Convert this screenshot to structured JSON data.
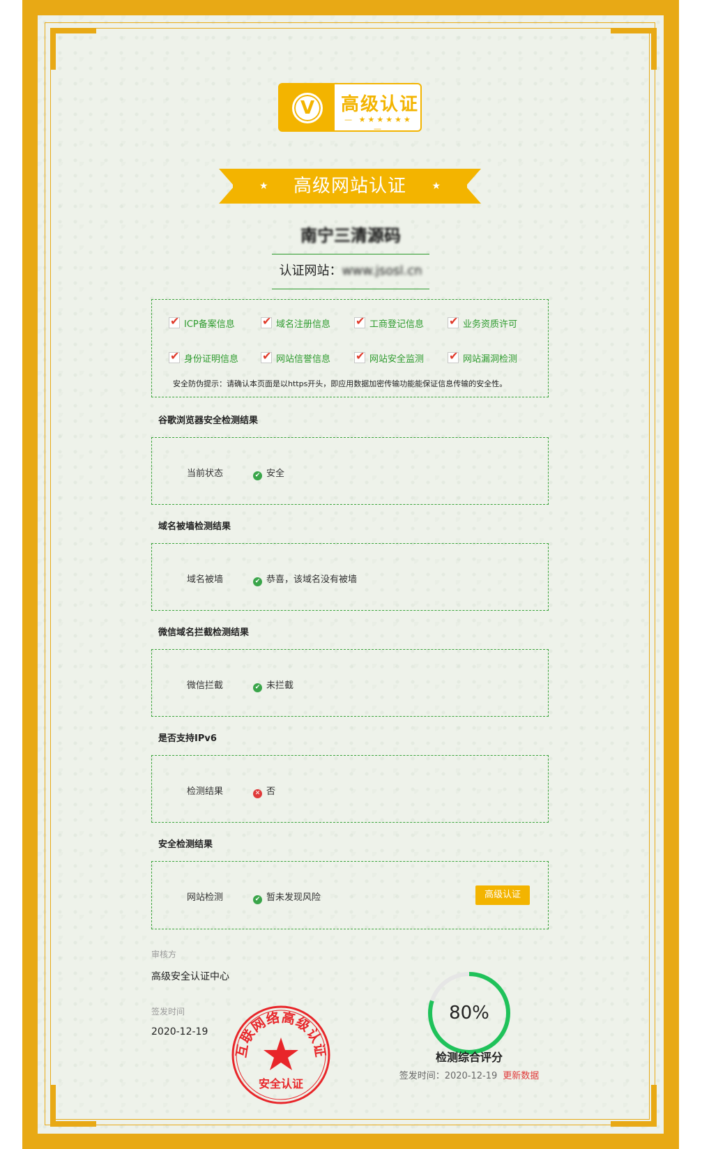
{
  "badge": {
    "letter": "V",
    "title": "高级认证",
    "stars": "— ★★★★★★ —"
  },
  "ribbon": {
    "title": "高级网站认证",
    "star": "★"
  },
  "site": {
    "name": "南宁三清源码",
    "url_label": "认证网站：",
    "url_value": "www.jsosl.cn"
  },
  "checks": [
    "ICP备案信息",
    "域名注册信息",
    "工商登记信息",
    "业务资质许可",
    "身份证明信息",
    "网站信誉信息",
    "网站安全监测",
    "网站漏洞检测"
  ],
  "tip": "安全防伪提示：请确认本页面是以https开头，即应用数据加密传输功能能保证信息传输的安全性。",
  "sections": [
    {
      "title": "谷歌浏览器安全检测结果",
      "label": "当前状态",
      "status": "ok",
      "value": "安全"
    },
    {
      "title": "域名被墙检测结果",
      "label": "域名被墙",
      "status": "ok",
      "value": "恭喜，该域名没有被墙"
    },
    {
      "title": "微信域名拦截检测结果",
      "label": "微信拦截",
      "status": "ok",
      "value": "未拦截"
    },
    {
      "title": "是否支持IPv6",
      "label": "检测结果",
      "status": "fail",
      "value": "否"
    },
    {
      "title": "安全检测结果",
      "label": "网站检测",
      "status": "ok",
      "value": "暂未发现风险",
      "button": "高级认证"
    }
  ],
  "auditor": {
    "label": "审核方",
    "value": "高级安全认证中心"
  },
  "issue": {
    "label": "签发时间",
    "value": "2020-12-19"
  },
  "seal": {
    "top_text": "互联网络高级认证",
    "bottom_text": "安全认证"
  },
  "score": {
    "percent": 80,
    "display": "80%",
    "title": "检测综合评分",
    "date_label": "签发时间：",
    "date_value": "2020-12-19",
    "update": "更新数据",
    "color": "#1fc25a"
  },
  "colors": {
    "frame": "#e8a915",
    "accent": "#f3b400",
    "green": "#3aa33a",
    "red": "#e03a3a"
  }
}
